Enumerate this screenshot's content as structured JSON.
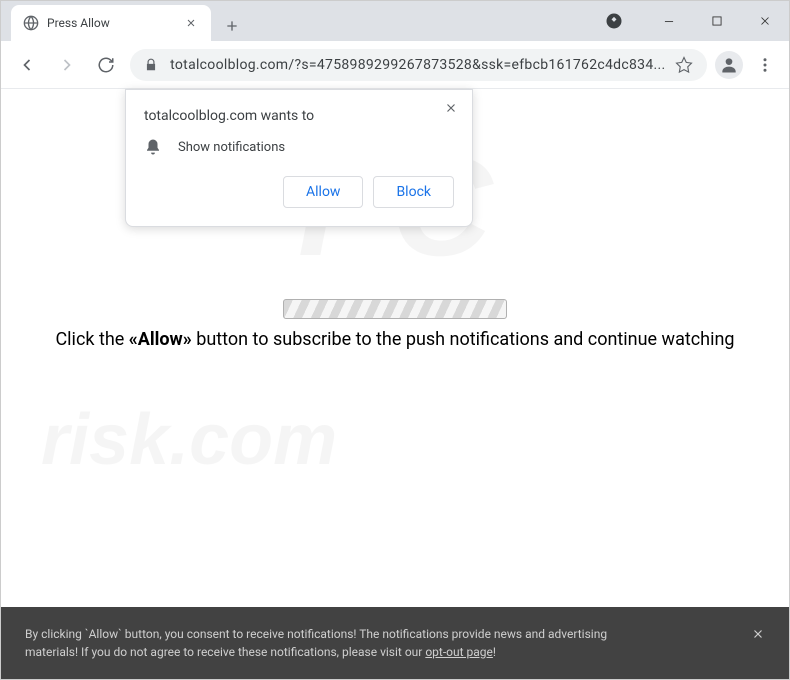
{
  "window": {
    "tab_title": "Press Allow",
    "url": "totalcoolblog.com/?s=4758989299267873528&ssk=efbcb161762c4dc834..."
  },
  "permission": {
    "title": "totalcoolblog.com wants to",
    "label": "Show notifications",
    "allow": "Allow",
    "block": "Block"
  },
  "content": {
    "prefix": "Click the ",
    "bold": "«Allow»",
    "suffix": " button to subscribe to the push notifications and continue watching"
  },
  "footer": {
    "line1": "By clicking `Allow` button, you consent to receive notifications! The notifications provide news and advertising",
    "line2": "materials! If you do not agree to receive these notifications, please visit our ",
    "link": "opt-out page",
    "after": "!"
  },
  "watermark": {
    "top": "PC",
    "bottom": "risk.com"
  }
}
